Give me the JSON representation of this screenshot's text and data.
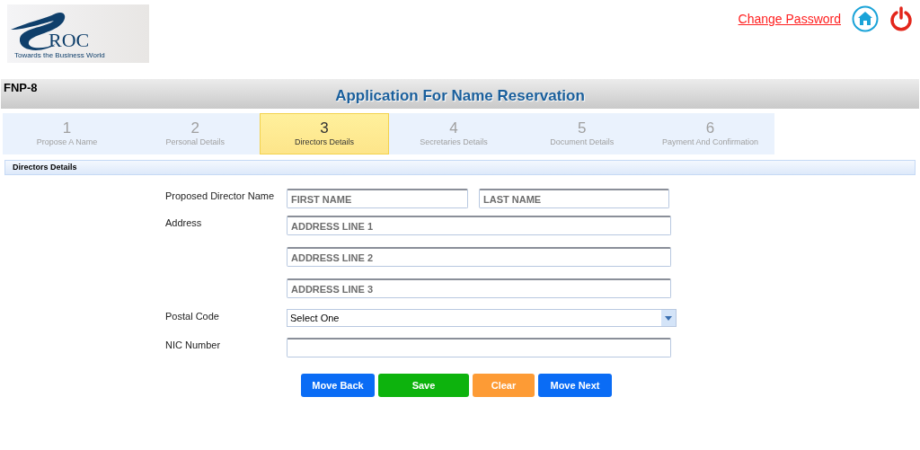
{
  "logo": {
    "mark": "ROC",
    "tagline": "Towards the Business World"
  },
  "top_links": {
    "change_password": "Change Password"
  },
  "header": {
    "form_code": "FNP-8",
    "title": "Application For Name Reservation"
  },
  "steps": [
    {
      "number": "1",
      "label": "Propose A Name",
      "selected": false
    },
    {
      "number": "2",
      "label": "Personal Details",
      "selected": false
    },
    {
      "number": "3",
      "label": "Directors Details",
      "selected": true
    },
    {
      "number": "4",
      "label": "Secretaries Details",
      "selected": false
    },
    {
      "number": "5",
      "label": "Document Details",
      "selected": false
    },
    {
      "number": "6",
      "label": "Payment And Confirmation",
      "selected": false
    }
  ],
  "section": {
    "title": "Directors Details"
  },
  "form": {
    "name_label": "Proposed Director Name",
    "first_name": {
      "placeholder": "FIRST NAME"
    },
    "last_name": {
      "placeholder": "LAST NAME"
    },
    "address_label": "Address",
    "address_lines": [
      {
        "placeholder": "ADDRESS LINE 1"
      },
      {
        "placeholder": "ADDRESS LINE 2"
      },
      {
        "placeholder": "ADDRESS LINE 3"
      }
    ],
    "postal_label": "Postal Code",
    "postal_select": {
      "value": "Select One"
    },
    "nic_label": "NIC Number"
  },
  "buttons": [
    {
      "label": "Move Back",
      "kind": "primary"
    },
    {
      "label": "Save",
      "kind": "success"
    },
    {
      "label": "Clear",
      "kind": "warning"
    },
    {
      "label": "Move Next",
      "kind": "primary"
    }
  ]
}
